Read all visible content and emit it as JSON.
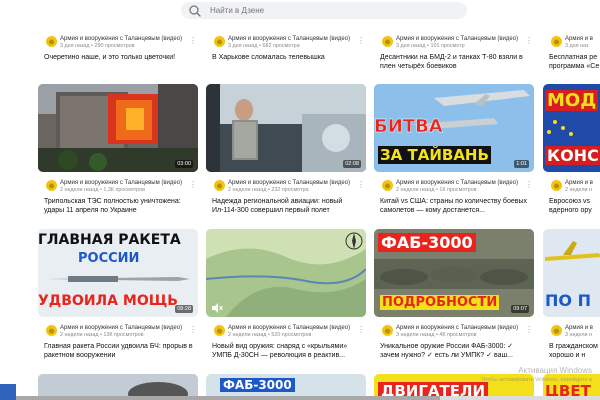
{
  "search": {
    "placeholder": "Найти в Дзене"
  },
  "row1": [
    {
      "channel": "Армия и вооружения с Таланцевым (видео)",
      "meta": "3 дня назад • 290 просмотров",
      "title": "Очеретино наше, и это только цветочки!"
    },
    {
      "channel": "Армия и вооружения с Таланцевым (видео)",
      "meta": "3 дня назад • 682 просмотра",
      "title": "В Харькове сломалась телевышка"
    },
    {
      "channel": "Армия и вооружения с Таланцевым (видео)",
      "meta": "3 дня назад • 101 просмотр",
      "title": "Десантники на БМД-2 и танках Т-80 взяли в плен четырёх боевиков"
    },
    {
      "channel": "Армия и в",
      "meta": "3 дня наз",
      "title": "Бесплатная ре программа «Се"
    }
  ],
  "row2": [
    {
      "channel": "Армия и вооружения с Таланцевым (видео)",
      "meta": "2 недели назад • 1,3К просмотров",
      "title": "Трипольская ТЭС полностью уничтожена: удары 11 апреля по Украине",
      "duration": "03:00"
    },
    {
      "channel": "Армия и вооружения с Таланцевым (видео)",
      "meta": "2 недели назад • 232 просмотра",
      "title": "Надежда региональной авиации: новый Ил-114-300 совершил первый полет",
      "duration": "02:08"
    },
    {
      "channel": "Армия и вооружения с Таланцевым (видео)",
      "meta": "2 недели назад • 1К просмотров",
      "title": "Китай vs США: страны по количеству боевых самолетов — кому достанется...",
      "duration": "1:01",
      "overlay1": "БИТВА",
      "overlay2": "ЗА ТАЙВАНЬ"
    },
    {
      "channel": "Армия и в",
      "meta": "2 недели н",
      "title": "Евросоюз vs вдерного ору",
      "overlay1": "МОД",
      "overlay2": "КОНС"
    }
  ],
  "row3": [
    {
      "channel": "Армия и вооружения с Таланцевым (видео)",
      "meta": "2 недели назад • 13К просмотров",
      "title": "Главная ракета России удвоила БЧ: прорыв в ракетном вооружении",
      "duration": "08:28",
      "overlay1": "ГЛАВНАЯ РАКЕТА",
      "overlay2": "РОССИИ",
      "overlay3": "УДВОИЛА МОЩЬ"
    },
    {
      "channel": "Армия и вооружения с Таланцевым (видео)",
      "meta": "2 недели назад • 520 просмотров",
      "title": "Новый вид оружия: снаряд с «крыльями» УМПБ Д-30СН — революция в реактив..."
    },
    {
      "channel": "Армия и вооружения с Таланцевым (видео)",
      "meta": "3 недели назад • 4К просмотров",
      "title": "Уникальное оружие России ФАБ-3000: ✓ зачем нужно? ✓ есть ли УМПК? ✓ ваш...",
      "duration": "09:07",
      "overlay1": "ФАБ-3000",
      "overlay2": "ПОДРОБНОСТИ"
    },
    {
      "channel": "Армия и в",
      "meta": "3 недели н",
      "title": "В гражданском хорошо и н",
      "overlay1": "ПО П"
    }
  ],
  "row4": [
    {
      "overlay1": ""
    },
    {
      "overlay1": "ФАБ-3000"
    },
    {
      "overlay1": "ДВИГАТЕЛИ"
    },
    {
      "overlay1": "ЦВЕТ"
    }
  ],
  "activation": {
    "line1": "Активация Windows",
    "line2": "Чтобы активировать Windows, перейдите в"
  },
  "colors": {
    "accent_red": "#e8241c",
    "avatar_yellow": "#f3c313",
    "search_bg": "#f1f2f4"
  }
}
